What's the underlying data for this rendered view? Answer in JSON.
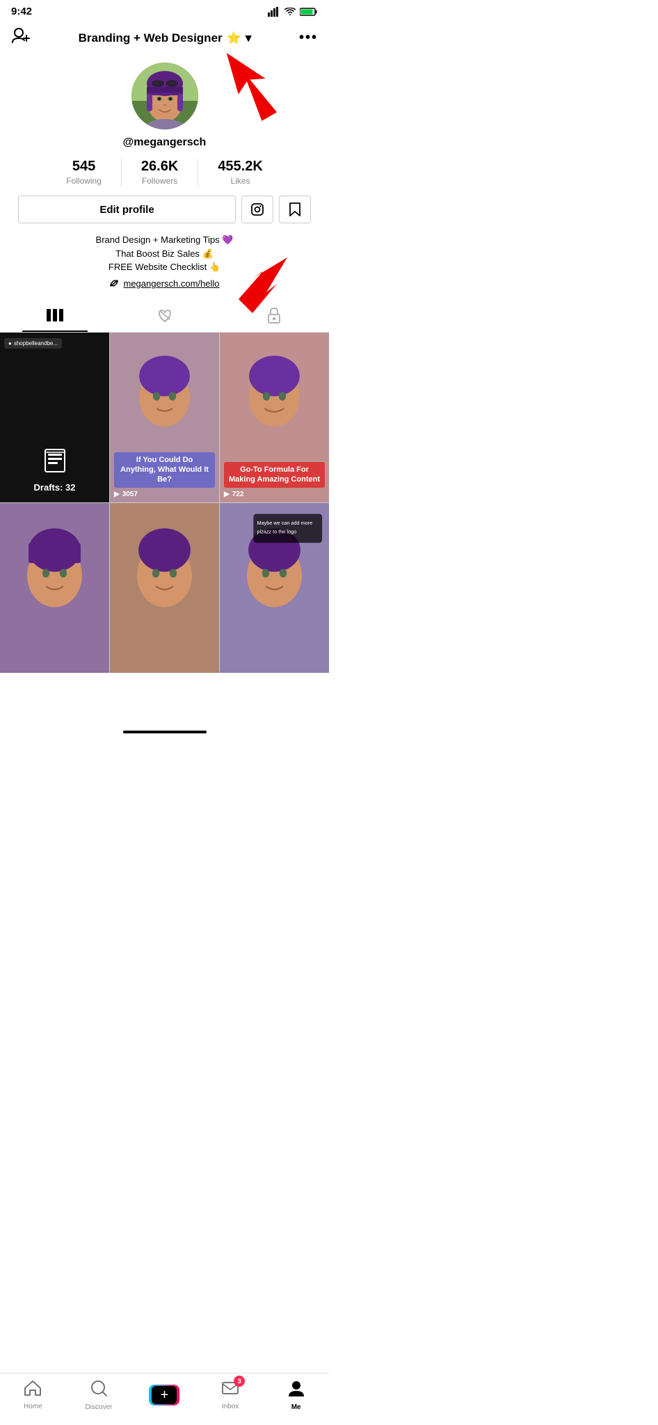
{
  "status_bar": {
    "time": "9:42",
    "signal_bars": "▂▄▆▇",
    "wifi": "wifi",
    "battery": "battery"
  },
  "top_nav": {
    "add_user_icon": "👤+",
    "title": "Branding + Web Designer",
    "title_emoji": "⭐",
    "dropdown_icon": "▾",
    "more_icon": "•••"
  },
  "profile": {
    "username": "@megangersch",
    "stats": {
      "following": {
        "count": "545",
        "label": "Following"
      },
      "followers": {
        "count": "26.6K",
        "label": "Followers"
      },
      "likes": {
        "count": "455.2K",
        "label": "Likes"
      }
    },
    "edit_button": "Edit profile",
    "bio_line1": "Brand Design + Marketing Tips 💜",
    "bio_line2": "That Boost Biz Sales 💰",
    "bio_line3": "FREE Website Checklist 👆",
    "link": "megangersch.com/hello"
  },
  "tabs": {
    "videos": "|||",
    "liked": "❤",
    "saved": "🔒"
  },
  "videos": [
    {
      "type": "drafts",
      "reply_tag": "shopbelleandbe...",
      "draft_count": "Drafts: 32"
    },
    {
      "caption": "If You Could Do Anything, What Would It Be?",
      "plays": "3057"
    },
    {
      "caption": "Go-To Formula For Making Amazing Content",
      "plays": "722"
    },
    {
      "caption": ""
    },
    {
      "caption": ""
    },
    {
      "caption": ""
    }
  ],
  "bottom_nav": {
    "home": "Home",
    "discover": "Discover",
    "plus": "+",
    "inbox": "Inbox",
    "inbox_badge": "3",
    "me": "Me"
  }
}
